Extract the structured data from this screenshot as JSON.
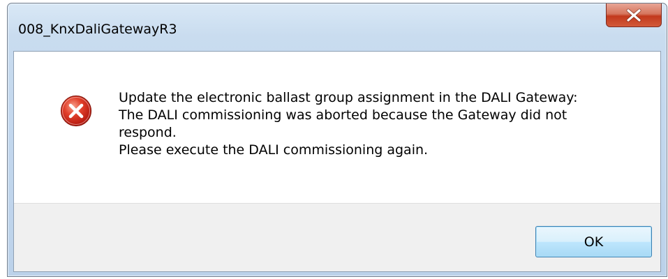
{
  "window": {
    "title": "008_KnxDaliGatewayR3",
    "close_icon": "close-icon"
  },
  "dialog": {
    "icon": "error-icon",
    "message_lines": [
      "Update the electronic ballast group assignment in the DALI Gateway:",
      "The DALI commissioning was aborted because the Gateway did not",
      "respond.",
      "Please execute the DALI commissioning again."
    ]
  },
  "buttons": {
    "ok_label": "OK"
  },
  "colors": {
    "close_button": "#c2391c",
    "error_icon": "#d8281c",
    "ok_button_border": "#3c7fb1"
  }
}
